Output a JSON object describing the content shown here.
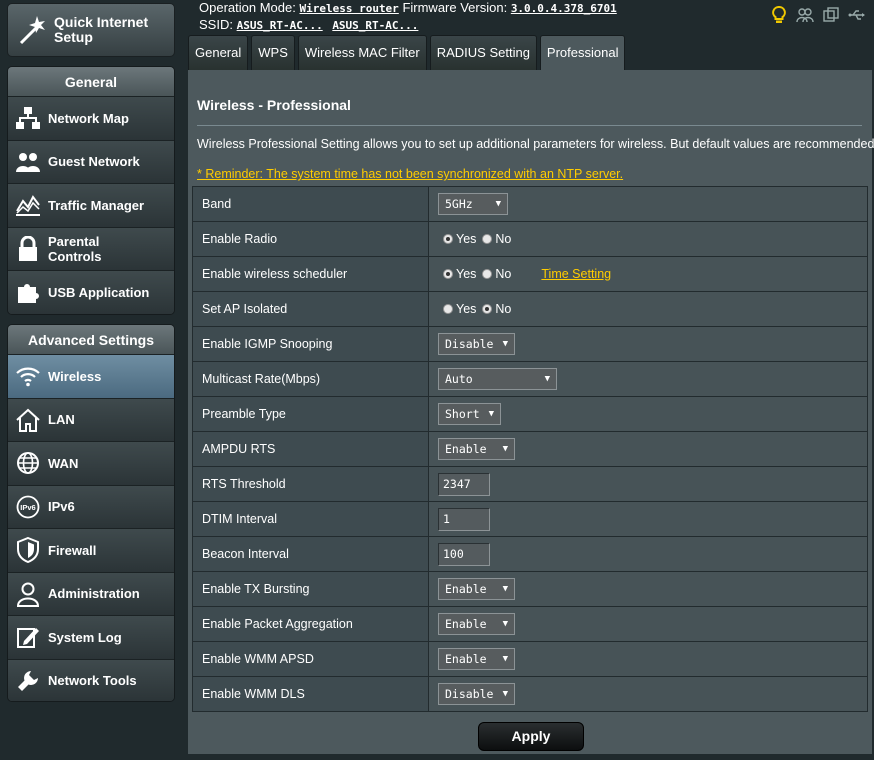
{
  "sidebar": {
    "quick_setup_label_1": "Quick Internet",
    "quick_setup_label_2": "Setup",
    "general_header": "General",
    "general_items": [
      {
        "label_1": "Network Map",
        "label_2": ""
      },
      {
        "label_1": "Guest Network",
        "label_2": ""
      },
      {
        "label_1": "Traffic Manager",
        "label_2": ""
      },
      {
        "label_1": "Parental",
        "label_2": "Controls"
      },
      {
        "label_1": "USB Application",
        "label_2": ""
      }
    ],
    "advanced_header": "Advanced Settings",
    "advanced_items": [
      {
        "label": "Wireless"
      },
      {
        "label": "LAN"
      },
      {
        "label": "WAN"
      },
      {
        "label": "IPv6"
      },
      {
        "label": "Firewall"
      },
      {
        "label": "Administration"
      },
      {
        "label": "System Log"
      },
      {
        "label": "Network Tools"
      }
    ]
  },
  "topbar": {
    "operation_mode_label": "Operation Mode:",
    "operation_mode_value": "Wireless router",
    "firmware_label": "Firmware Version:",
    "firmware_value": "3.0.0.4.378_6701",
    "ssid_label": "SSID:",
    "ssid_1": "ASUS_RT-AC...",
    "ssid_2": "ASUS_RT-AC..."
  },
  "tabs": [
    "General",
    "WPS",
    "Wireless MAC Filter",
    "RADIUS Setting",
    "Professional"
  ],
  "content": {
    "title": "Wireless - Professional",
    "description": "Wireless Professional Setting allows you to set up additional parameters for wireless. But default values are recommended.",
    "reminder": "* Reminder: The system time has not been synchronized with an NTP server.",
    "radio_yes": "Yes",
    "radio_no": "No",
    "time_setting": "Time Setting",
    "apply": "Apply"
  },
  "settings": {
    "band": {
      "label": "Band",
      "value": "5GHz"
    },
    "enable_radio": {
      "label": "Enable Radio",
      "value": "Yes"
    },
    "scheduler": {
      "label": "Enable wireless scheduler",
      "value": "Yes"
    },
    "ap_isolated": {
      "label": "Set AP Isolated",
      "value": "No"
    },
    "igmp": {
      "label": "Enable IGMP Snooping",
      "value": "Disable"
    },
    "multicast": {
      "label": "Multicast Rate(Mbps)",
      "value": "Auto"
    },
    "preamble": {
      "label": "Preamble Type",
      "value": "Short"
    },
    "ampdu_rts": {
      "label": "AMPDU RTS",
      "value": "Enable"
    },
    "rts_threshold": {
      "label": "RTS Threshold",
      "value": "2347"
    },
    "dtim": {
      "label": "DTIM Interval",
      "value": "1"
    },
    "beacon": {
      "label": "Beacon Interval",
      "value": "100"
    },
    "tx_bursting": {
      "label": "Enable TX Bursting",
      "value": "Enable"
    },
    "packet_agg": {
      "label": "Enable Packet Aggregation",
      "value": "Enable"
    },
    "wmm_apsd": {
      "label": "Enable WMM APSD",
      "value": "Enable"
    },
    "wmm_dls": {
      "label": "Enable WMM DLS",
      "value": "Disable"
    }
  }
}
